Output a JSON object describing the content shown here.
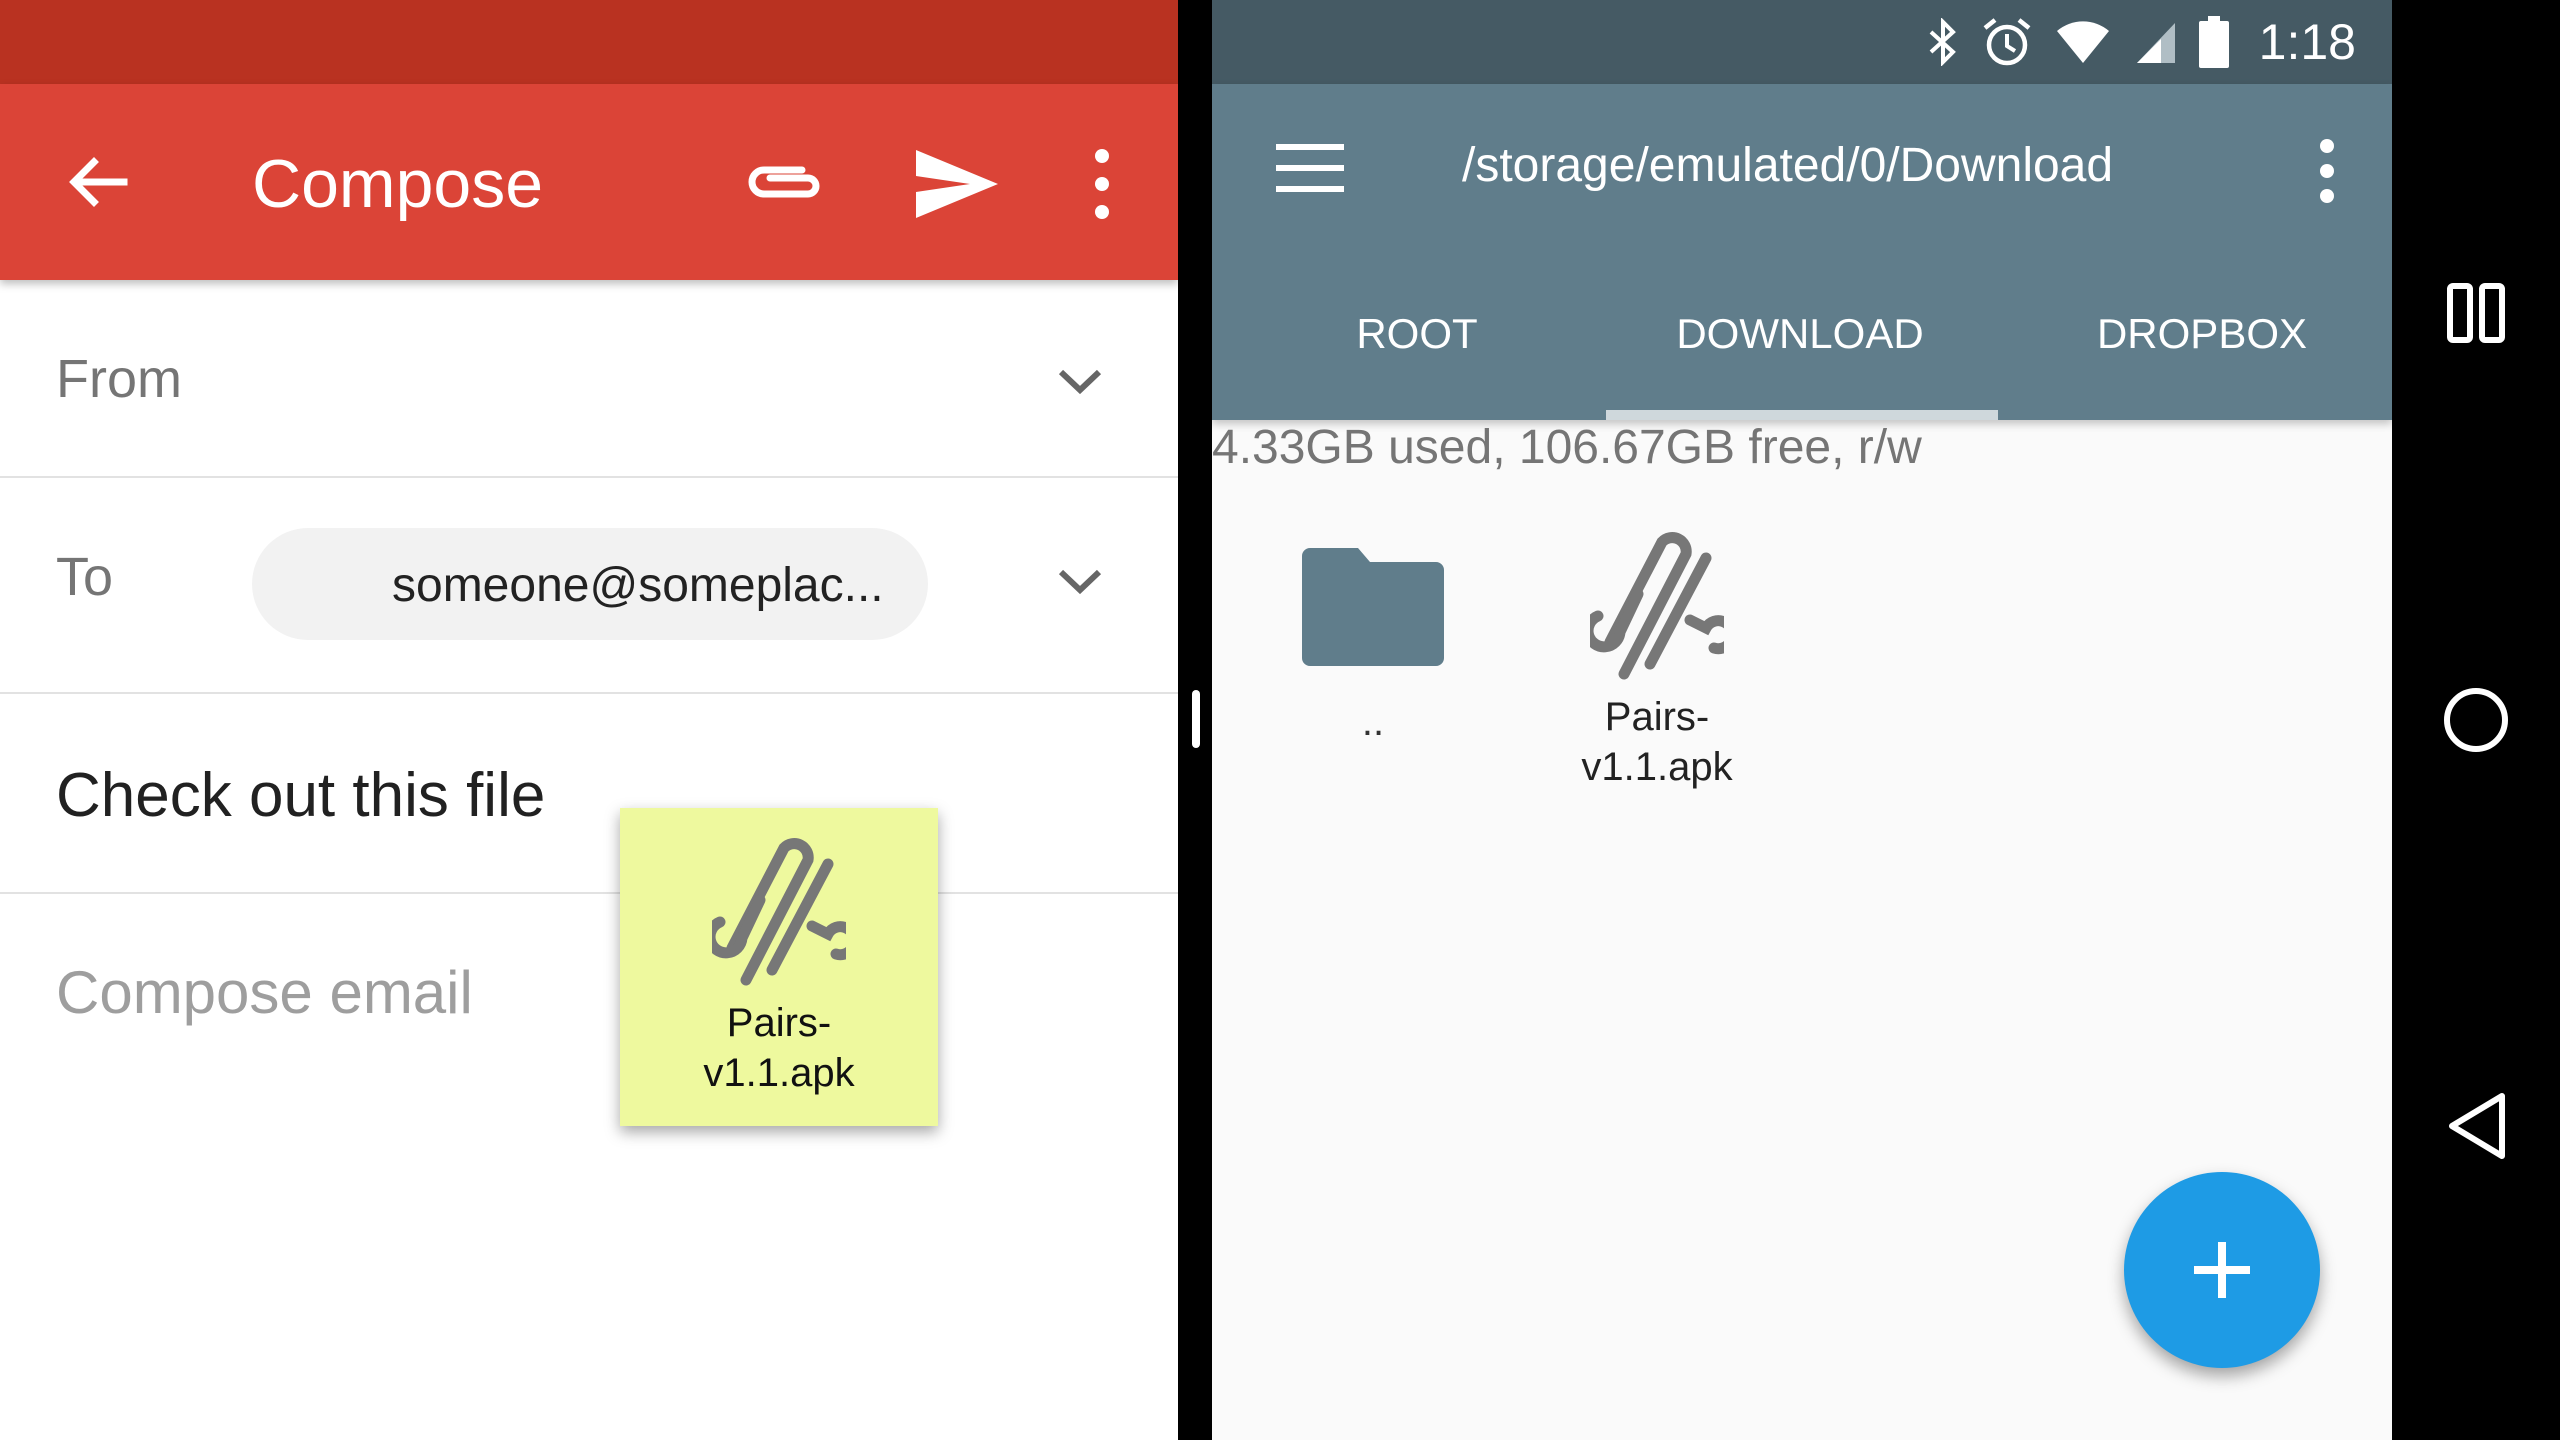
{
  "compose": {
    "title": "Compose",
    "from_label": "From",
    "to_label": "To",
    "to_chip": "someone@someplac...",
    "subject": "Check out this file",
    "body_placeholder": "Compose email",
    "colors": {
      "appbar": "#db4437",
      "statusbar": "#b93221"
    }
  },
  "drag_item": {
    "name_line1": "Pairs-",
    "name_line2": "v1.1.apk",
    "icon": "apk-clip-icon"
  },
  "file_manager": {
    "status_time": "1:18",
    "path": "/storage/emulated/0/Download",
    "tabs": [
      {
        "label": "ROOT"
      },
      {
        "label": "DOWNLOAD",
        "selected": true
      },
      {
        "label": "DROPBOX"
      }
    ],
    "storage_info": "4.33GB used, 106.67GB free, r/w",
    "items": [
      {
        "label": "..",
        "icon": "folder-icon"
      },
      {
        "label_line1": "Pairs-",
        "label_line2": "v1.1.apk",
        "icon": "apk-clip-icon"
      }
    ],
    "fab_icon": "plus-icon",
    "colors": {
      "appbar": "#607d8b",
      "statusbar": "#455a64",
      "fab": "#1e9be5"
    }
  },
  "navbar": {
    "icons": [
      "recents-icon",
      "home-icon",
      "back-icon"
    ]
  }
}
